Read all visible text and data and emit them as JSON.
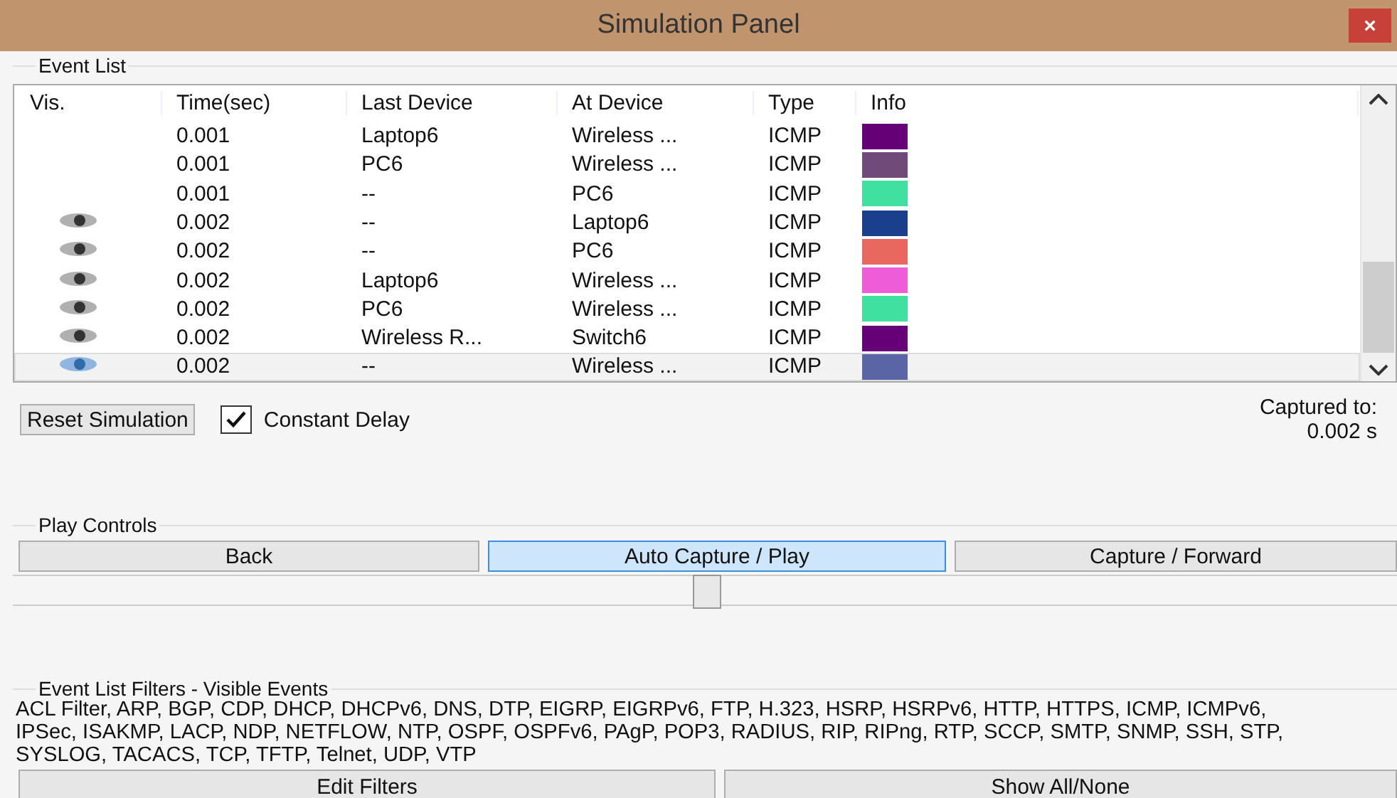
{
  "window": {
    "title": "Simulation Panel",
    "close": "×"
  },
  "event_list": {
    "label": "Event List",
    "columns": [
      "Vis.",
      "Time(sec)",
      "Last Device",
      "At Device",
      "Type",
      "Info"
    ],
    "rows": [
      {
        "visible": false,
        "selected": false,
        "time": "0.001",
        "last_device": "Laptop6",
        "at_device": "Wireless ...",
        "type": "ICMP",
        "color": "#660077"
      },
      {
        "visible": false,
        "selected": false,
        "time": "0.001",
        "last_device": "PC6",
        "at_device": "Wireless ...",
        "type": "ICMP",
        "color": "#704b7a"
      },
      {
        "visible": false,
        "selected": false,
        "time": "0.001",
        "last_device": "--",
        "at_device": "PC6",
        "type": "ICMP",
        "color": "#40e0a0"
      },
      {
        "visible": true,
        "selected": false,
        "time": "0.002",
        "last_device": "--",
        "at_device": "Laptop6",
        "type": "ICMP",
        "color": "#1a3f8c"
      },
      {
        "visible": true,
        "selected": false,
        "time": "0.002",
        "last_device": "--",
        "at_device": "PC6",
        "type": "ICMP",
        "color": "#e8675f"
      },
      {
        "visible": true,
        "selected": false,
        "time": "0.002",
        "last_device": "Laptop6",
        "at_device": "Wireless ...",
        "type": "ICMP",
        "color": "#ee5cd8"
      },
      {
        "visible": true,
        "selected": false,
        "time": "0.002",
        "last_device": "PC6",
        "at_device": "Wireless ...",
        "type": "ICMP",
        "color": "#40e0a0"
      },
      {
        "visible": true,
        "selected": false,
        "time": "0.002",
        "last_device": "Wireless R...",
        "at_device": "Switch6",
        "type": "ICMP",
        "color": "#660077"
      },
      {
        "visible": true,
        "selected": true,
        "time": "0.002",
        "last_device": "--",
        "at_device": "Wireless ...",
        "type": "ICMP",
        "color": "#5a65a5"
      }
    ],
    "reset_button": "Reset Simulation",
    "constant_delay": {
      "label": "Constant Delay",
      "checked": true
    },
    "captured_label": "Captured to:",
    "captured_value": "0.002 s"
  },
  "play_controls": {
    "label": "Play Controls",
    "buttons": [
      {
        "label": "Back",
        "selected": false
      },
      {
        "label": "Auto Capture / Play",
        "selected": true
      },
      {
        "label": "Capture / Forward",
        "selected": false
      }
    ],
    "slider": {
      "level": 0.5
    }
  },
  "filters": {
    "label": "Event List Filters - Visible Events",
    "text": "ACL Filter, ARP, BGP, CDP, DHCP, DHCPv6, DNS, DTP, EIGRP, EIGRPv6, FTP, H.323, HSRP, HSRPv6, HTTP, HTTPS, ICMP, ICMPv6, IPSec, ISAKMP, LACP, NDP, NETFLOW, NTP, OSPF, OSPFv6, PAgP, POP3, RADIUS, RIP, RIPng, RTP, SCCP, SMTP, SNMP, SSH, STP, SYSLOG, TACACS, TCP, TFTP, Telnet, UDP, VTP",
    "buttons": [
      "Edit Filters",
      "Show All/None"
    ]
  }
}
